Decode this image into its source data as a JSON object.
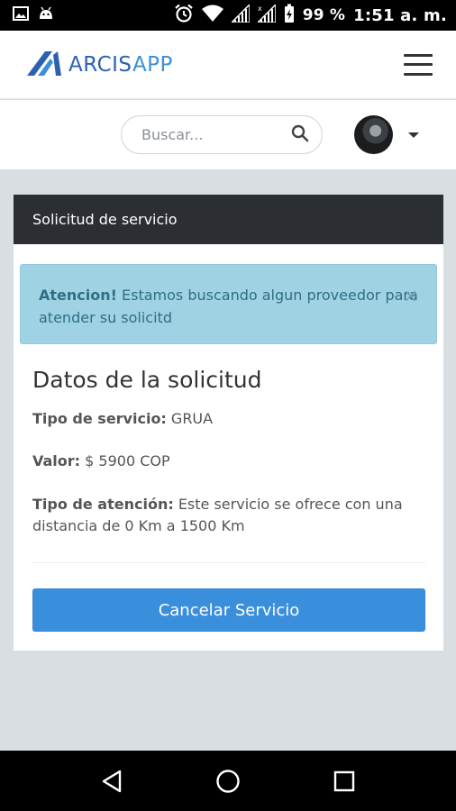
{
  "status_bar": {
    "battery_percent": "99 %",
    "time": "1:51 a. m."
  },
  "header": {
    "brand_part1": "ARCIS",
    "brand_part2": "APP"
  },
  "search": {
    "placeholder": "Buscar..."
  },
  "card": {
    "header_title": "Solicitud de servicio",
    "alert": {
      "strong": "Atencion!",
      "text": " Estamos buscando algun proveedor para atender su solicitd",
      "close": "×"
    },
    "section_title": "Datos de la solicitud",
    "service_type": {
      "label": "Tipo de servicio:",
      "value": " GRUA"
    },
    "price": {
      "label": "Valor:",
      "value": " $ 5900 COP"
    },
    "attention_type": {
      "label": "Tipo de atención:",
      "value": "  Este servicio se ofrece con una distancia de 0 Km a 1500 Km"
    },
    "cancel_label": "Cancelar Servicio"
  },
  "colors": {
    "primary": "#3a8fdc",
    "header_dark": "#2b2e33",
    "alert_bg": "#9fd3e4",
    "alert_text": "#2f6e84",
    "page_bg": "#d9dee3"
  }
}
